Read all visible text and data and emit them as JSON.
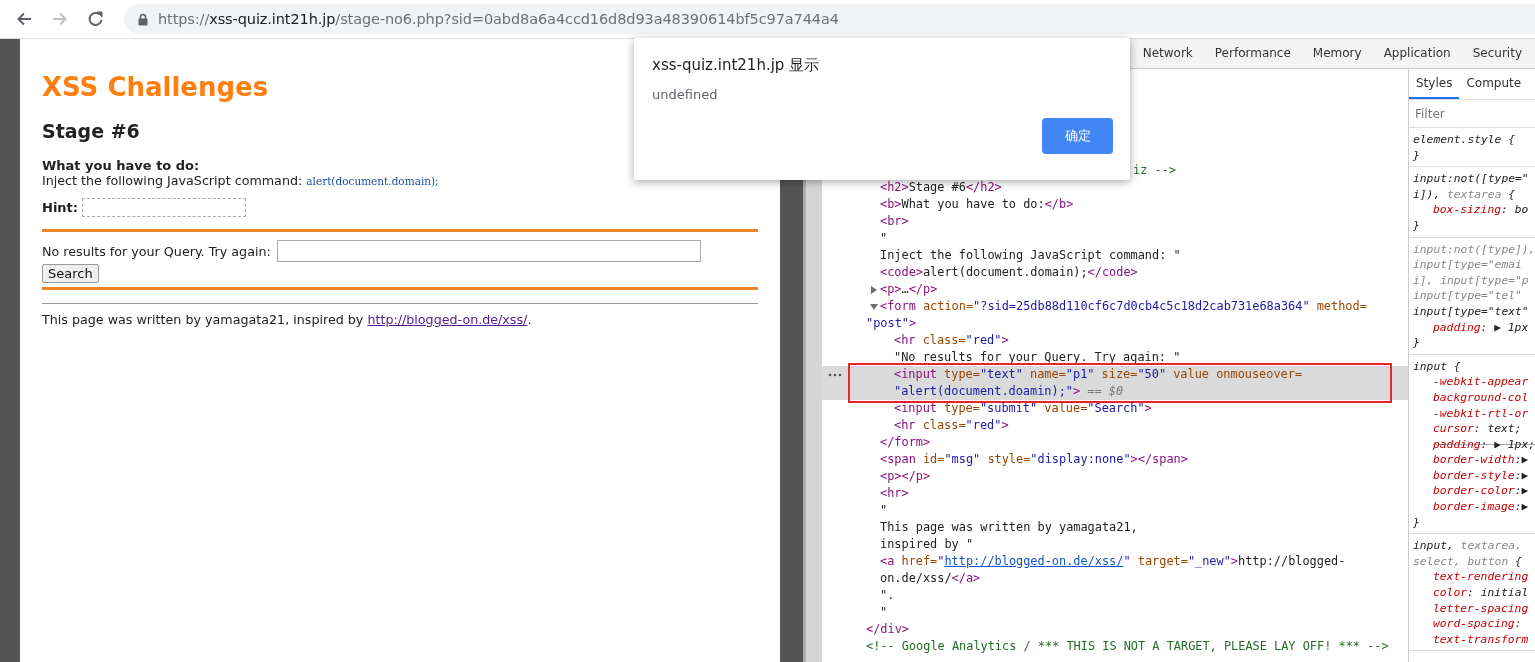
{
  "browser": {
    "nav": [
      {
        "kind": "back",
        "disabled": false
      },
      {
        "kind": "forward",
        "disabled": true
      },
      {
        "kind": "reload",
        "disabled": false
      }
    ],
    "url": {
      "scheme": "https://",
      "host": "xss-quiz.int21h.jp",
      "path": "/stage-no6.php?sid=0abd8a6a4ccd16d8d93a48390614bf5c97a744a4"
    }
  },
  "page": {
    "title": "XSS Challenges",
    "stage": "Stage #6",
    "task_label": "What you have to do:",
    "instruction": "Inject the following JavaScript command: ",
    "command": "alert(document.domain);",
    "hint_label": "Hint:",
    "query_label": "No results for your Query. Try again:",
    "search_button": "Search",
    "footer": {
      "text": "This page was written by yamagata21, inspired by ",
      "link": "http://blogged-on.de/xss/",
      "after": "."
    }
  },
  "dialog": {
    "title": "xss-quiz.int21h.jp 显示",
    "message": "undefined",
    "button": "确定"
  },
  "devtools": {
    "tabs": [
      {
        "label": "Network",
        "selected": false
      },
      {
        "label": "Performance",
        "selected": false
      },
      {
        "label": "Memory",
        "selected": false
      },
      {
        "label": "Application",
        "selected": false
      },
      {
        "label": "Security",
        "selected": false
      }
    ],
    "elements": {
      "nodes": [
        {
          "closing": [
            {
              "kind": "tag",
              "text": "</div>"
            }
          ],
          "children": [
            {
              "covered": true,
              "selected": false,
              "lines": [
                [
                  {
                    "kind": "comment",
                    "text": "iz -->"
                  }
                ]
              ]
            },
            {
              "selected": false,
              "lines": [
                [
                  {
                    "kind": "tag",
                    "text": "<h2>"
                  },
                  {
                    "kind": "text",
                    "text": "Stage #6"
                  },
                  {
                    "kind": "tag",
                    "text": "</h2>"
                  }
                ]
              ]
            },
            {
              "selected": false,
              "lines": [
                [
                  {
                    "kind": "tag",
                    "text": "<b>"
                  },
                  {
                    "kind": "text",
                    "text": "What you have to do:"
                  },
                  {
                    "kind": "tag",
                    "text": "</b>"
                  }
                ]
              ]
            },
            {
              "selected": false,
              "lines": [
                [
                  {
                    "kind": "tag",
                    "text": "<br>"
                  }
                ]
              ]
            },
            {
              "selected": false,
              "lines": [
                [
                  {
                    "kind": "text",
                    "text": "\""
                  }
                ],
                [
                  {
                    "kind": "text",
                    "text": "Inject the following JavaScript command: \""
                  }
                ]
              ]
            },
            {
              "selected": false,
              "lines": [
                [
                  {
                    "kind": "tag",
                    "text": "<code>"
                  },
                  {
                    "kind": "text",
                    "text": "alert(document.domain);"
                  },
                  {
                    "kind": "tag",
                    "text": "</code>"
                  }
                ]
              ]
            },
            {
              "selected": false,
              "expanded": false,
              "lines": [
                [
                  {
                    "kind": "tag",
                    "text": "<p>"
                  },
                  {
                    "kind": "text",
                    "text": "…"
                  },
                  {
                    "kind": "tag",
                    "text": "</p>"
                  }
                ]
              ]
            },
            {
              "selected": false,
              "expanded": true,
              "closing": [
                {
                  "kind": "tag",
                  "text": "</form>"
                }
              ],
              "lines": [
                [
                  {
                    "kind": "tag",
                    "text": "<form"
                  },
                  {
                    "kind": "attr",
                    "text": " action="
                  },
                  {
                    "kind": "val",
                    "text": "\"?sid=25db88d110cf6c7d0cb4c5c18d2cab731e68a364\""
                  },
                  {
                    "kind": "attr",
                    "text": " method="
                  }
                ],
                [
                  {
                    "kind": "val",
                    "text": "\"post\""
                  },
                  {
                    "kind": "tag",
                    "text": ">"
                  }
                ]
              ],
              "children": [
                {
                  "selected": false,
                  "lines": [
                    [
                      {
                        "kind": "tag",
                        "text": "<hr"
                      },
                      {
                        "kind": "attr",
                        "text": " class="
                      },
                      {
                        "kind": "val",
                        "text": "\"red\""
                      },
                      {
                        "kind": "tag",
                        "text": ">"
                      }
                    ]
                  ]
                },
                {
                  "selected": false,
                  "lines": [
                    [
                      {
                        "kind": "text",
                        "text": "\"No results for your Query. Try again: \""
                      }
                    ]
                  ]
                },
                {
                  "selected": true,
                  "annotated": true,
                  "lines": [
                    [
                      {
                        "kind": "tag",
                        "text": "<input"
                      },
                      {
                        "kind": "attr",
                        "text": " type="
                      },
                      {
                        "kind": "val",
                        "text": "\"text\""
                      },
                      {
                        "kind": "attr",
                        "text": " name="
                      },
                      {
                        "kind": "val",
                        "text": "\"p1\""
                      },
                      {
                        "kind": "attr",
                        "text": " size="
                      },
                      {
                        "kind": "val",
                        "text": "\"50\""
                      },
                      {
                        "kind": "attr",
                        "text": " value onmouseover="
                      }
                    ],
                    [
                      {
                        "kind": "val",
                        "text": "\"alert(document.doamin);\""
                      },
                      {
                        "kind": "tag",
                        "text": ">"
                      },
                      {
                        "kind": "dim",
                        "text": " == $0"
                      }
                    ]
                  ]
                },
                {
                  "selected": false,
                  "lines": [
                    [
                      {
                        "kind": "tag",
                        "text": "<input"
                      },
                      {
                        "kind": "attr",
                        "text": " type="
                      },
                      {
                        "kind": "val",
                        "text": "\"submit\""
                      },
                      {
                        "kind": "attr",
                        "text": " value="
                      },
                      {
                        "kind": "val",
                        "text": "\"Search\""
                      },
                      {
                        "kind": "tag",
                        "text": ">"
                      }
                    ]
                  ]
                },
                {
                  "selected": false,
                  "lines": [
                    [
                      {
                        "kind": "tag",
                        "text": "<hr"
                      },
                      {
                        "kind": "attr",
                        "text": " class="
                      },
                      {
                        "kind": "val",
                        "text": "\"red\""
                      },
                      {
                        "kind": "tag",
                        "text": ">"
                      }
                    ]
                  ]
                }
              ]
            },
            {
              "selected": false,
              "lines": [
                [
                  {
                    "kind": "tag",
                    "text": "<span"
                  },
                  {
                    "kind": "attr",
                    "text": " id="
                  },
                  {
                    "kind": "val",
                    "text": "\"msg\""
                  },
                  {
                    "kind": "attr",
                    "text": " style="
                  },
                  {
                    "kind": "val",
                    "text": "\"display:none\""
                  },
                  {
                    "kind": "tag",
                    "text": "></span>"
                  }
                ]
              ]
            },
            {
              "selected": false,
              "lines": [
                [
                  {
                    "kind": "tag",
                    "text": "<p></p>"
                  }
                ]
              ]
            },
            {
              "selected": false,
              "lines": [
                [
                  {
                    "kind": "tag",
                    "text": "<hr>"
                  }
                ]
              ]
            },
            {
              "selected": false,
              "lines": [
                [
                  {
                    "kind": "text",
                    "text": "\""
                  }
                ],
                [
                  {
                    "kind": "text",
                    "text": "This page was written by yamagata21,"
                  }
                ],
                [
                  {
                    "kind": "text",
                    "text": "inspired by \""
                  }
                ]
              ]
            },
            {
              "selected": false,
              "lines": [
                [
                  {
                    "kind": "tag",
                    "text": "<a"
                  },
                  {
                    "kind": "attr",
                    "text": " href="
                  },
                  {
                    "kind": "val",
                    "text": "\""
                  },
                  {
                    "kind": "link",
                    "text": "http://blogged-on.de/xss/"
                  },
                  {
                    "kind": "val",
                    "text": "\""
                  },
                  {
                    "kind": "attr",
                    "text": " target="
                  },
                  {
                    "kind": "val",
                    "text": "\"_new\""
                  },
                  {
                    "kind": "tag",
                    "text": ">"
                  },
                  {
                    "kind": "text",
                    "text": "http://blogged-"
                  }
                ],
                [
                  {
                    "kind": "text",
                    "text": "on.de/xss/"
                  },
                  {
                    "kind": "tag",
                    "text": "</a>"
                  }
                ]
              ]
            },
            {
              "selected": false,
              "lines": [
                [
                  {
                    "kind": "text",
                    "text": "\"."
                  }
                ],
                [
                  {
                    "kind": "text",
                    "text": "\""
                  }
                ]
              ]
            }
          ]
        },
        {
          "selected": false,
          "lines": [
            [
              {
                "kind": "comment",
                "text": "<!-- Google Analytics / *** THIS IS NOT A TARGET, PLEASE LAY OFF! *** -->"
              }
            ]
          ]
        }
      ]
    },
    "styles": {
      "tabs": [
        {
          "label": "Styles",
          "selected": true
        },
        {
          "label": "Compute",
          "selected": false
        }
      ],
      "filter": {
        "placeholder": "Filter"
      },
      "rules": [
        {
          "lines": [
            {
              "kind": "selector",
              "overridden": false,
              "tokens": [
                {
                  "kind": "sel",
                  "text": "element.style"
                },
                {
                  "kind": "punct",
                  "text": " {"
                }
              ]
            },
            {
              "kind": "close",
              "overridden": false,
              "tokens": [
                {
                  "kind": "punct",
                  "text": "}"
                }
              ]
            }
          ]
        },
        {
          "lines": [
            {
              "kind": "selector",
              "overridden": false,
              "tokens": [
                {
                  "kind": "sel",
                  "text": "input:not([type=\""
                }
              ]
            },
            {
              "kind": "selector",
              "overridden": false,
              "tokens": [
                {
                  "kind": "sel",
                  "text": "i]),"
                },
                {
                  "kind": "unsel",
                  "text": " textarea"
                },
                {
                  "kind": "punct",
                  "text": " {"
                }
              ]
            },
            {
              "kind": "property",
              "overridden": false,
              "tokens": [
                {
                  "kind": "prop",
                  "text": "box-sizing"
                },
                {
                  "kind": "punct",
                  "text": ": "
                },
                {
                  "kind": "val",
                  "text": "bo"
                }
              ]
            },
            {
              "kind": "close",
              "overridden": false,
              "tokens": [
                {
                  "kind": "punct",
                  "text": "}"
                }
              ]
            }
          ]
        },
        {
          "lines": [
            {
              "kind": "selector",
              "overridden": false,
              "tokens": [
                {
                  "kind": "unsel",
                  "text": "input:not([type]),"
                }
              ]
            },
            {
              "kind": "selector",
              "overridden": false,
              "tokens": [
                {
                  "kind": "unsel",
                  "text": "input[type=\"emai"
                }
              ]
            },
            {
              "kind": "selector",
              "overridden": false,
              "tokens": [
                {
                  "kind": "unsel",
                  "text": "i], input[type=\"p"
                }
              ]
            },
            {
              "kind": "selector",
              "overridden": false,
              "tokens": [
                {
                  "kind": "unsel",
                  "text": "input[type=\"tel\""
                }
              ]
            },
            {
              "kind": "selector",
              "overridden": false,
              "tokens": [
                {
                  "kind": "sel",
                  "text": "input[type=\"text\""
                }
              ]
            },
            {
              "kind": "property",
              "overridden": false,
              "tokens": [
                {
                  "kind": "prop",
                  "text": "padding"
                },
                {
                  "kind": "punct",
                  "text": ": "
                },
                {
                  "kind": "val",
                  "text": "▶ 1px"
                }
              ]
            },
            {
              "kind": "close",
              "overridden": false,
              "tokens": [
                {
                  "kind": "punct",
                  "text": "}"
                }
              ]
            }
          ]
        },
        {
          "lines": [
            {
              "kind": "selector",
              "overridden": false,
              "tokens": [
                {
                  "kind": "sel",
                  "text": "input"
                },
                {
                  "kind": "punct",
                  "text": " {"
                }
              ]
            },
            {
              "kind": "property",
              "overridden": false,
              "tokens": [
                {
                  "kind": "prop",
                  "text": "-webkit-appear"
                }
              ]
            },
            {
              "kind": "property",
              "overridden": false,
              "tokens": [
                {
                  "kind": "prop",
                  "text": "background-col"
                }
              ]
            },
            {
              "kind": "property",
              "overridden": false,
              "tokens": [
                {
                  "kind": "prop",
                  "text": "-webkit-rtl-or"
                }
              ]
            },
            {
              "kind": "property",
              "overridden": false,
              "tokens": [
                {
                  "kind": "prop",
                  "text": "cursor"
                },
                {
                  "kind": "punct",
                  "text": ": "
                },
                {
                  "kind": "val",
                  "text": "text;"
                }
              ]
            },
            {
              "kind": "property",
              "overridden": true,
              "tokens": [
                {
                  "kind": "prop",
                  "text": "padding"
                },
                {
                  "kind": "punct",
                  "text": ": "
                },
                {
                  "kind": "val",
                  "text": "▶ 1px;"
                }
              ]
            },
            {
              "kind": "property",
              "overridden": false,
              "tokens": [
                {
                  "kind": "prop",
                  "text": "border-width"
                },
                {
                  "kind": "punct",
                  "text": ":"
                },
                {
                  "kind": "val",
                  "text": "▶"
                }
              ]
            },
            {
              "kind": "property",
              "overridden": false,
              "tokens": [
                {
                  "kind": "prop",
                  "text": "border-style"
                },
                {
                  "kind": "punct",
                  "text": ":"
                },
                {
                  "kind": "val",
                  "text": "▶"
                }
              ]
            },
            {
              "kind": "property",
              "overridden": false,
              "tokens": [
                {
                  "kind": "prop",
                  "text": "border-color"
                },
                {
                  "kind": "punct",
                  "text": ":"
                },
                {
                  "kind": "val",
                  "text": "▶"
                }
              ]
            },
            {
              "kind": "property",
              "overridden": false,
              "tokens": [
                {
                  "kind": "prop",
                  "text": "border-image"
                },
                {
                  "kind": "punct",
                  "text": ":"
                },
                {
                  "kind": "val",
                  "text": "▶"
                }
              ]
            },
            {
              "kind": "close",
              "overridden": false,
              "tokens": [
                {
                  "kind": "punct",
                  "text": "}"
                }
              ]
            }
          ]
        },
        {
          "lines": [
            {
              "kind": "selector",
              "overridden": false,
              "tokens": [
                {
                  "kind": "sel",
                  "text": "input,"
                },
                {
                  "kind": "unsel",
                  "text": " textarea,"
                }
              ]
            },
            {
              "kind": "selector",
              "overridden": false,
              "tokens": [
                {
                  "kind": "unsel",
                  "text": "select, button"
                },
                {
                  "kind": "punct",
                  "text": " {"
                }
              ]
            },
            {
              "kind": "property",
              "overridden": false,
              "tokens": [
                {
                  "kind": "prop",
                  "text": "text-rendering"
                }
              ]
            },
            {
              "kind": "property",
              "overridden": false,
              "tokens": [
                {
                  "kind": "prop",
                  "text": "color"
                },
                {
                  "kind": "punct",
                  "text": ": "
                },
                {
                  "kind": "val",
                  "text": "initial"
                }
              ]
            },
            {
              "kind": "property",
              "overridden": false,
              "tokens": [
                {
                  "kind": "prop",
                  "text": "letter-spacing"
                }
              ]
            },
            {
              "kind": "property",
              "overridden": false,
              "tokens": [
                {
                  "kind": "prop",
                  "text": "word-spacing"
                },
                {
                  "kind": "punct",
                  "text": ":"
                }
              ]
            },
            {
              "kind": "property",
              "overridden": false,
              "tokens": [
                {
                  "kind": "prop",
                  "text": "text-transform"
                }
              ]
            }
          ]
        }
      ]
    }
  }
}
